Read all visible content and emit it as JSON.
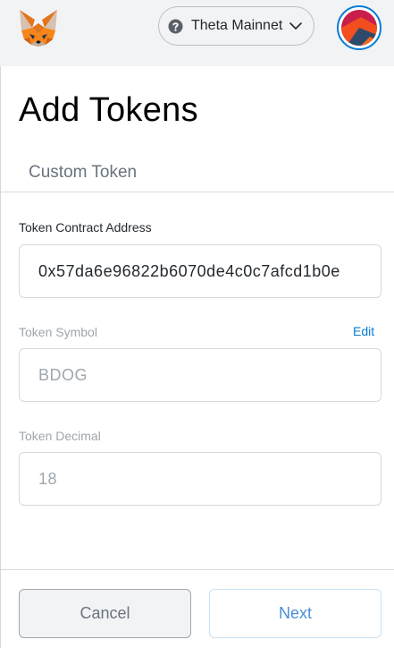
{
  "header": {
    "logo_icon": "metamask-fox-icon",
    "network": {
      "label": "Theta Mainnet",
      "icon": "question-circle-icon",
      "dropdown_icon": "chevron-down-icon"
    },
    "account_icon": "account-identicon"
  },
  "page": {
    "title": "Add Tokens",
    "tab_label": "Custom Token"
  },
  "form": {
    "contract_address": {
      "label": "Token Contract Address",
      "value": "0x57da6e96822b6070de4c0c7afcd1b0e"
    },
    "symbol": {
      "label": "Token Symbol",
      "edit_label": "Edit",
      "value": "BDOG"
    },
    "decimal": {
      "label": "Token Decimal",
      "value": "18"
    }
  },
  "footer": {
    "cancel_label": "Cancel",
    "next_label": "Next"
  },
  "colors": {
    "accent": "#037dd6",
    "header_bg": "#f2f3f4",
    "muted_text": "#9fa6ae",
    "next_text": "#4a8fd8"
  }
}
